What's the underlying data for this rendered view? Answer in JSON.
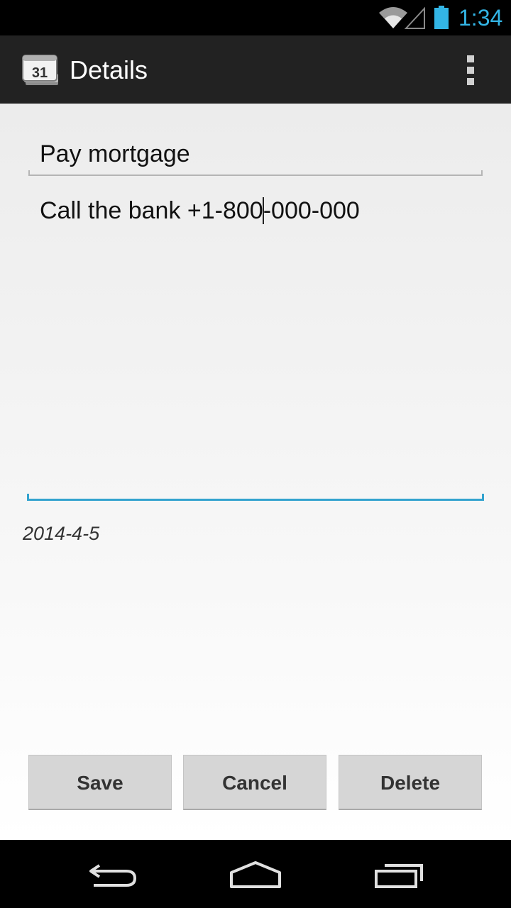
{
  "status_bar": {
    "time": "1:34",
    "icons": [
      "wifi-icon",
      "cell-signal-icon",
      "battery-icon"
    ],
    "accent_color": "#33b5e5"
  },
  "action_bar": {
    "title": "Details",
    "app_icon": "calendar-icon",
    "app_icon_text": "31",
    "overflow_icon": "overflow-menu-icon"
  },
  "form": {
    "title_value": "Pay mortgage",
    "notes_before_caret": "Call the bank +1-800",
    "notes_after_caret": "-000-000",
    "date": "2014-4-5",
    "focus_color": "#33a3cf"
  },
  "buttons": {
    "save": "Save",
    "cancel": "Cancel",
    "delete": "Delete"
  },
  "nav_bar": {
    "icons": [
      "back-icon",
      "home-icon",
      "recent-apps-icon"
    ]
  }
}
